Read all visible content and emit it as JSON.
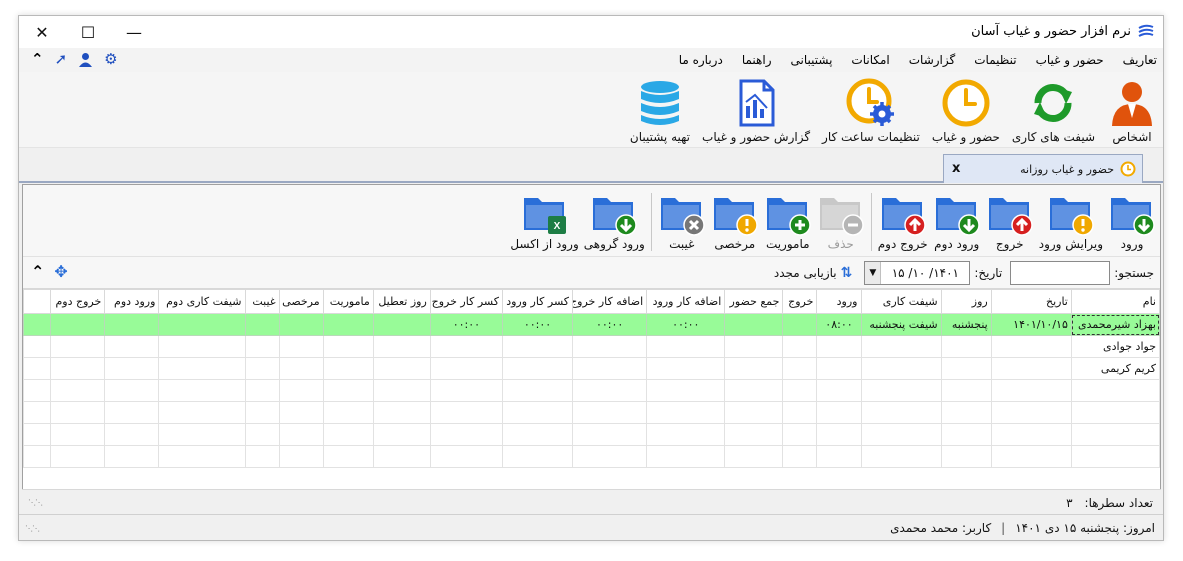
{
  "window": {
    "title": "نرم افزار حضور و غیاب آسان",
    "controls": [
      "✕",
      "☐",
      "—"
    ]
  },
  "menu": {
    "items": [
      "تعاریف",
      "حضور و غیاب",
      "تنظیمات",
      "گزارشات",
      "امکانات",
      "پشتیبانی",
      "راهنما",
      "درباره ما"
    ]
  },
  "ribbon": {
    "buttons": [
      {
        "label": "اشخاص",
        "icon": "person-icon"
      },
      {
        "label": "شیفت های کاری",
        "icon": "refresh-shift-icon"
      },
      {
        "label": "حضور و غیاب",
        "icon": "clock-icon"
      },
      {
        "label": "تنظیمات ساعت کار",
        "icon": "clock-gear-icon"
      },
      {
        "label": "گزارش حضور و غیاب",
        "icon": "report-chart-icon"
      },
      {
        "label": "تهیه پشتیبان",
        "icon": "database-icon"
      }
    ]
  },
  "tab": {
    "label": "حضور و غیاب روزانه",
    "close": "x"
  },
  "toolbar": {
    "group1": [
      {
        "label": "ورود",
        "badge": "down-arrow",
        "badge_color": "#1e8a1e"
      },
      {
        "label": "ویرایش ورود",
        "badge": "exclamation",
        "badge_color": "#f0a800"
      },
      {
        "label": "خروج",
        "badge": "up-arrow",
        "badge_color": "#d62020"
      },
      {
        "label": "ورود دوم",
        "badge": "down-arrow",
        "badge_color": "#1e8a1e"
      },
      {
        "label": "خروج دوم",
        "badge": "up-arrow",
        "badge_color": "#d62020"
      }
    ],
    "group2": [
      {
        "label": "حذف",
        "badge": "minus",
        "badge_color": "#b5b5b5",
        "disabled": true
      },
      {
        "label": "ماموریت",
        "badge": "plus",
        "badge_color": "#1e8a1e"
      },
      {
        "label": "مرخصی",
        "badge": "exclamation",
        "badge_color": "#f0a800"
      },
      {
        "label": "غیبت",
        "badge": "x",
        "badge_color": "#777777"
      }
    ],
    "group3": [
      {
        "label": "ورود گروهی",
        "badge": "down-arrow",
        "badge_color": "#1e8a1e"
      },
      {
        "label": "ورود از اکسل",
        "badge": "excel",
        "badge_color": "#1d7d45"
      }
    ]
  },
  "filter": {
    "search_label": "جستجو:",
    "date_label": "تاریخ:",
    "date_value": "۱۴۰۱/ ۱۰/ ۱۵",
    "refresh_label": "بازیابی مجدد"
  },
  "grid": {
    "columns": [
      "نام",
      "تاریخ",
      "روز",
      "شیفت کاری",
      "ورود",
      "خروج",
      "جمع حضور",
      "اضافه کار ورود",
      "اضافه کار خروج",
      "کسر کار ورود",
      "کسر کار خروج",
      "روز تعطیل",
      "ماموریت",
      "مرخصی",
      "غیبت",
      "شیفت کاری دوم",
      "ورود دوم",
      "خروج دوم"
    ],
    "rows": [
      [
        "بهزاد شیرمحمدی",
        "۱۴۰۱/۱۰/۱۵",
        "پنجشنبه",
        "شیفت پنجشنبه",
        "۰۸:۰۰",
        "",
        "",
        "۰۰:۰۰",
        "۰۰:۰۰",
        "۰۰:۰۰",
        "۰۰:۰۰",
        "",
        "",
        "",
        "",
        "",
        "",
        ""
      ],
      [
        "جواد جوادی",
        "",
        "",
        "",
        "",
        "",
        "",
        "",
        "",
        "",
        "",
        "",
        "",
        "",
        "",
        "",
        "",
        ""
      ],
      [
        "کریم کریمی",
        "",
        "",
        "",
        "",
        "",
        "",
        "",
        "",
        "",
        "",
        "",
        "",
        "",
        "",
        "",
        "",
        ""
      ]
    ],
    "selected_row": 0
  },
  "count": {
    "label": "تعداد سطرها:",
    "value": "۳"
  },
  "status": {
    "today": "امروز: پنجشنبه ۱۵ دی ۱۴۰۱",
    "separator": "|",
    "user": "کاربر: محمد محمدی"
  }
}
